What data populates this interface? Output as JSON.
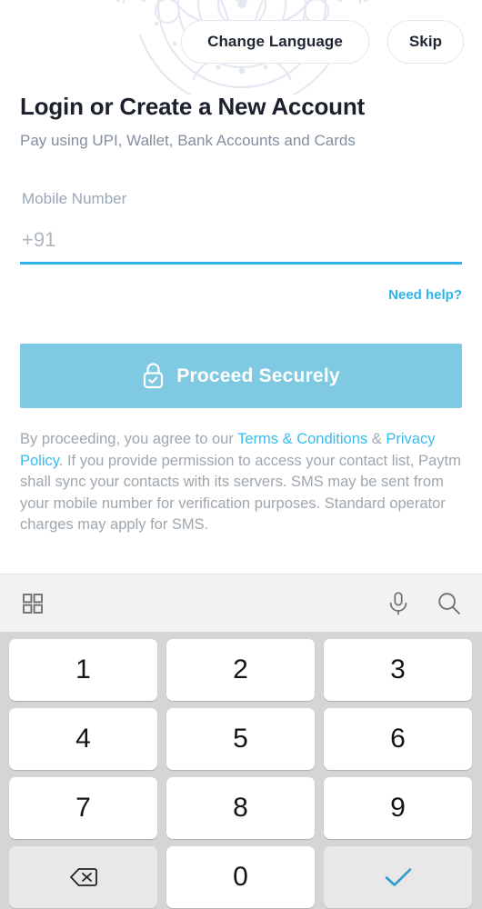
{
  "header": {
    "change_language_label": "Change Language",
    "skip_label": "Skip"
  },
  "main": {
    "title": "Login or Create a New Account",
    "subtitle": "Pay using UPI, Wallet, Bank Accounts and Cards",
    "mobile_field": {
      "label": "Mobile Number",
      "value": "",
      "placeholder": "+91"
    },
    "need_help_label": "Need help?",
    "cta_label": "Proceed Securely",
    "cta_icon": "lock-check-icon",
    "terms": {
      "part1": "By proceeding, you agree to our ",
      "link_terms": "Terms & Conditions",
      "part2": " & ",
      "link_privacy": "Privacy Policy",
      "part3": ". If you provide permission to access your contact list, Paytm shall sync your contacts with its servers. SMS may be sent from your mobile number for verification purposes. Standard operator charges may apply for SMS."
    }
  },
  "keyboard": {
    "toolbar": {
      "grid_icon": "grid-apps-icon",
      "mic_icon": "microphone-icon",
      "search_icon": "search-icon"
    },
    "keys": [
      {
        "label": "1",
        "name": "key-1",
        "type": "digit"
      },
      {
        "label": "2",
        "name": "key-2",
        "type": "digit"
      },
      {
        "label": "3",
        "name": "key-3",
        "type": "digit"
      },
      {
        "label": "4",
        "name": "key-4",
        "type": "digit"
      },
      {
        "label": "5",
        "name": "key-5",
        "type": "digit"
      },
      {
        "label": "6",
        "name": "key-6",
        "type": "digit"
      },
      {
        "label": "7",
        "name": "key-7",
        "type": "digit"
      },
      {
        "label": "8",
        "name": "key-8",
        "type": "digit"
      },
      {
        "label": "9",
        "name": "key-9",
        "type": "digit"
      },
      {
        "label": "",
        "name": "key-backspace",
        "type": "func",
        "icon": "backspace-icon"
      },
      {
        "label": "0",
        "name": "key-0",
        "type": "digit"
      },
      {
        "label": "",
        "name": "key-enter-confirm",
        "type": "func",
        "icon": "checkmark-icon"
      }
    ]
  },
  "colors": {
    "accent_cyan": "#2eb4e8",
    "link_cyan": "#35bdf0",
    "cta_blue": "#7fc9e3",
    "title_navy": "#1b212c",
    "subtitle_gray": "#81909f",
    "keyboard_bg": "#d5d5d5",
    "keyboard_toolbar_bg": "#f2f2f2",
    "mandala_line": "#e4e9f1"
  }
}
